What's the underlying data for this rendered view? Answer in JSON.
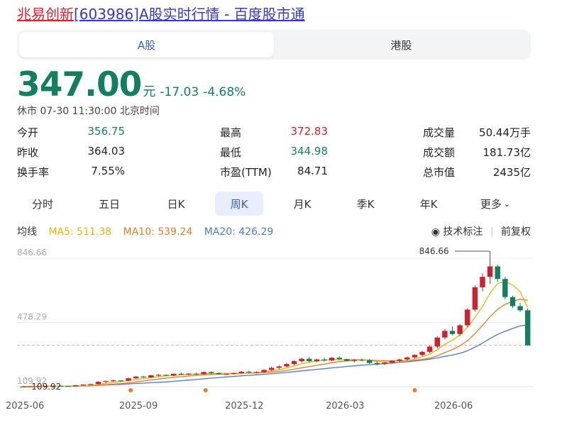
{
  "page": {
    "title_name": "兆易创新",
    "title_code": "[603986]",
    "title_rest": "A股实时行情 - 百度股市通"
  },
  "market_tabs": [
    {
      "label": "A股",
      "active": true
    },
    {
      "label": "港股",
      "active": false
    }
  ],
  "quote": {
    "price": "347.00",
    "unit": "元",
    "change": "-17.03",
    "change_pct": "-4.68%",
    "status": "休市 07-30 11:30:00 北京时间"
  },
  "stats": {
    "open_label": "今开",
    "open": "356.75",
    "prev_close_label": "昨收",
    "prev_close": "364.03",
    "turnover_label": "换手率",
    "turnover": "7.55%",
    "high_label": "最高",
    "high": "372.83",
    "low_label": "最低",
    "low": "344.98",
    "pe_label": "市盈(TTM)",
    "pe": "84.71",
    "volume_label": "成交量",
    "volume": "50.44万手",
    "amount_label": "成交额",
    "amount": "181.73亿",
    "mktcap_label": "总市值",
    "mktcap": "2435亿"
  },
  "period_tabs": [
    {
      "label": "分时",
      "active": false
    },
    {
      "label": "五日",
      "active": false
    },
    {
      "label": "日K",
      "active": false
    },
    {
      "label": "周K",
      "active": true
    },
    {
      "label": "月K",
      "active": false
    },
    {
      "label": "季K",
      "active": false
    },
    {
      "label": "年K",
      "active": false
    },
    {
      "label": "更多",
      "active": false
    }
  ],
  "ma": {
    "label": "均线",
    "ma5": "MA5: 511.38",
    "ma10": "MA10: 539.24",
    "ma20": "MA20: 426.29"
  },
  "tools": {
    "indicator_label": "技术标注",
    "adjust_label": "前复权"
  },
  "colors": {
    "up": "#d0202b",
    "down": "#128060",
    "ma5": "#f0b400",
    "ma10": "#f07820",
    "ma20": "#4a78d8",
    "accent": "#3b5cc6"
  },
  "chart_data": {
    "type": "candlestick",
    "y_ticks": [
      "846.66",
      "478.29",
      "109.92"
    ],
    "x_ticks": [
      "2025-06",
      "2025-09",
      "2025-12",
      "2026-03",
      "2026-06"
    ],
    "ylim": [
      109.92,
      846.66
    ],
    "max_label": "846.66",
    "min_label": "109.92",
    "reference_line": 347.0,
    "candles": [
      [
        110,
        112,
        109,
        111
      ],
      [
        111,
        113,
        110,
        112
      ],
      [
        112,
        114,
        111,
        113
      ],
      [
        113,
        115,
        112,
        114
      ],
      [
        114,
        116,
        113,
        115
      ],
      [
        115,
        116,
        113,
        114
      ],
      [
        114,
        115,
        109.92,
        112
      ],
      [
        112,
        120,
        111,
        118
      ],
      [
        118,
        124,
        116,
        122
      ],
      [
        122,
        126,
        120,
        125
      ],
      [
        125,
        140,
        123,
        138
      ],
      [
        138,
        146,
        132,
        142
      ],
      [
        142,
        150,
        138,
        146
      ],
      [
        146,
        148,
        140,
        144
      ],
      [
        144,
        160,
        142,
        158
      ],
      [
        158,
        170,
        156,
        168
      ],
      [
        168,
        172,
        160,
        163
      ],
      [
        163,
        178,
        160,
        175
      ],
      [
        175,
        182,
        168,
        178
      ],
      [
        178,
        180,
        172,
        174
      ],
      [
        174,
        186,
        170,
        184
      ],
      [
        184,
        192,
        176,
        180
      ],
      [
        180,
        188,
        175,
        185
      ],
      [
        185,
        190,
        178,
        182
      ],
      [
        182,
        196,
        180,
        194
      ],
      [
        194,
        198,
        184,
        188
      ],
      [
        188,
        192,
        178,
        181
      ],
      [
        181,
        186,
        176,
        184
      ],
      [
        184,
        190,
        180,
        188
      ],
      [
        188,
        200,
        184,
        196
      ],
      [
        196,
        202,
        188,
        192
      ],
      [
        192,
        198,
        186,
        194
      ],
      [
        194,
        210,
        190,
        206
      ],
      [
        206,
        224,
        200,
        218
      ],
      [
        218,
        232,
        210,
        226
      ],
      [
        226,
        246,
        220,
        240
      ],
      [
        240,
        262,
        232,
        256
      ],
      [
        256,
        276,
        248,
        270
      ],
      [
        270,
        280,
        248,
        256
      ],
      [
        256,
        272,
        250,
        266
      ],
      [
        266,
        276,
        254,
        260
      ],
      [
        260,
        280,
        256,
        276
      ],
      [
        276,
        284,
        262,
        268
      ],
      [
        268,
        272,
        254,
        258
      ],
      [
        258,
        268,
        250,
        264
      ],
      [
        264,
        272,
        256,
        262
      ],
      [
        262,
        268,
        240,
        246
      ],
      [
        246,
        256,
        232,
        240
      ],
      [
        240,
        252,
        234,
        248
      ],
      [
        248,
        262,
        242,
        258
      ],
      [
        258,
        270,
        250,
        266
      ],
      [
        266,
        282,
        258,
        278
      ],
      [
        278,
        296,
        270,
        292
      ],
      [
        292,
        316,
        284,
        310
      ],
      [
        310,
        348,
        302,
        340
      ],
      [
        340,
        400,
        330,
        392
      ],
      [
        392,
        440,
        380,
        430
      ],
      [
        430,
        456,
        404,
        412
      ],
      [
        412,
        470,
        400,
        462
      ],
      [
        462,
        560,
        450,
        552
      ],
      [
        552,
        690,
        540,
        680
      ],
      [
        680,
        760,
        656,
        740
      ],
      [
        740,
        846.66,
        700,
        800
      ],
      [
        800,
        812,
        712,
        728
      ],
      [
        728,
        740,
        610,
        624
      ],
      [
        624,
        632,
        560,
        572
      ],
      [
        572,
        590,
        538,
        548
      ],
      [
        548,
        560,
        344.98,
        347
      ]
    ],
    "ma5": [],
    "ma10": [],
    "ma20": []
  }
}
